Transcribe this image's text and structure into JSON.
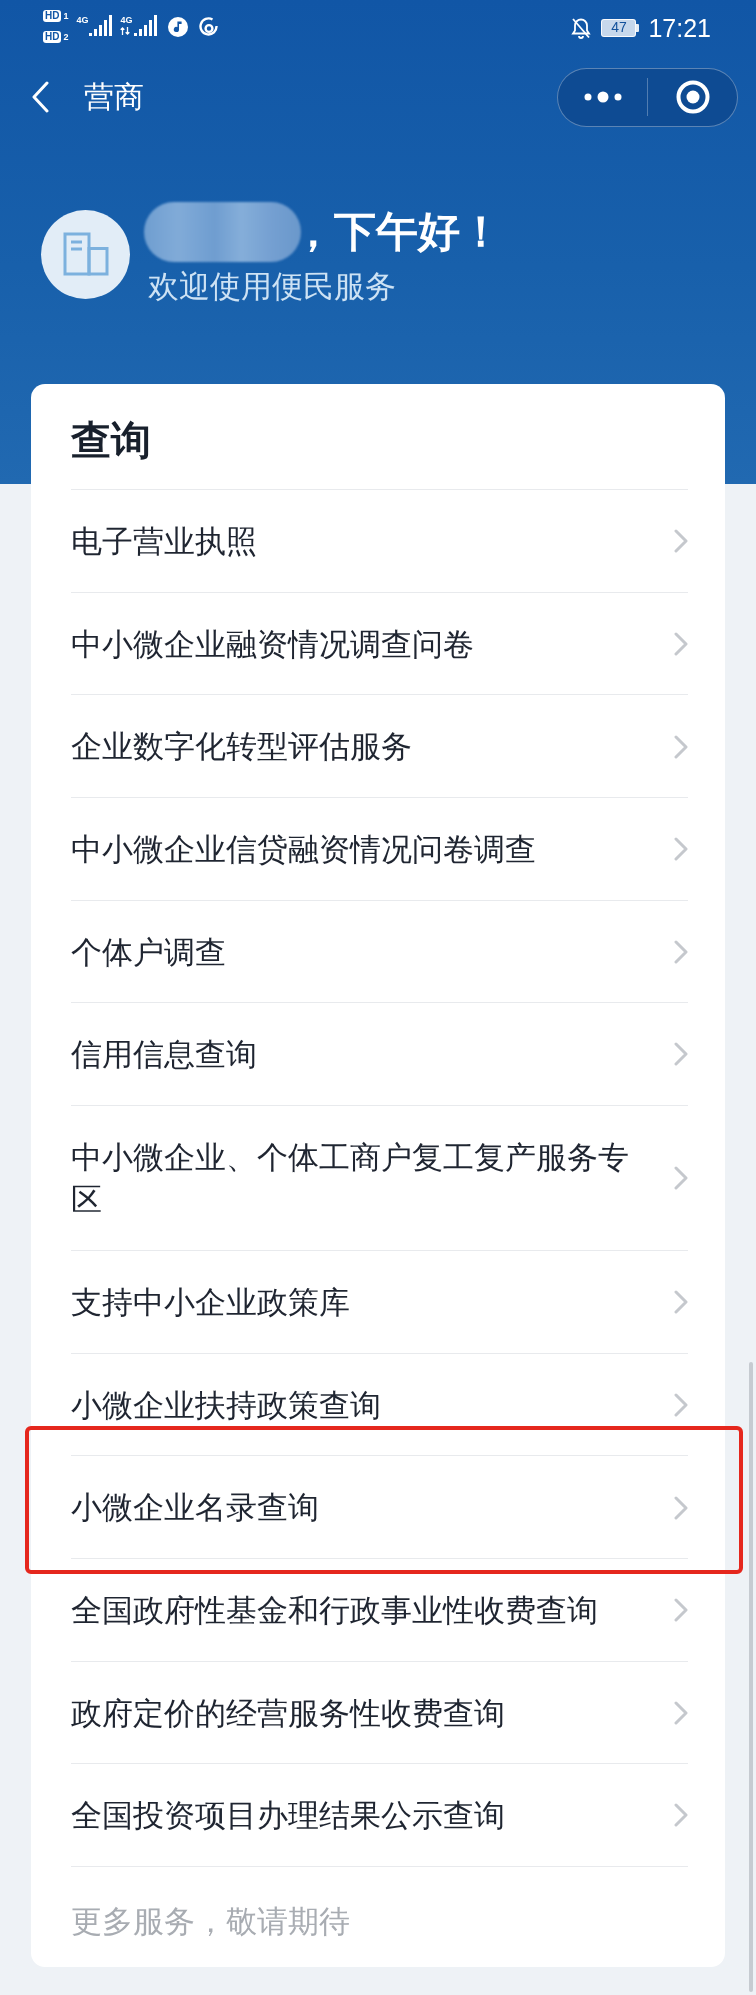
{
  "status_bar": {
    "sim_badges": [
      {
        "label": "HD",
        "slot": "1"
      },
      {
        "label": "HD",
        "slot": "2"
      }
    ],
    "networks": [
      {
        "label": "4G",
        "data_arrows": false
      },
      {
        "label": "4G",
        "data_arrows": true
      }
    ],
    "battery": "47",
    "time": "17:21"
  },
  "nav_bar": {
    "title": "营商"
  },
  "greeting": {
    "name_blurred": true,
    "text": "，下午好！",
    "subtitle": "欢迎使用便民服务"
  },
  "sections": [
    {
      "title": "查询",
      "items": [
        {
          "label": "电子营业执照",
          "highlighted": false
        },
        {
          "label": "中小微企业融资情况调查问卷",
          "highlighted": false
        },
        {
          "label": "企业数字化转型评估服务",
          "highlighted": false
        },
        {
          "label": "中小微企业信贷融资情况问卷调查",
          "highlighted": false
        },
        {
          "label": "个体户调查",
          "highlighted": false
        },
        {
          "label": "信用信息查询",
          "highlighted": false
        },
        {
          "label": "中小微企业、个体工商户复工复产服务专区",
          "highlighted": false
        },
        {
          "label": "支持中小企业政策库",
          "highlighted": false
        },
        {
          "label": "小微企业扶持政策查询",
          "highlighted": false
        },
        {
          "label": "小微企业名录查询",
          "highlighted": true
        },
        {
          "label": "全国政府性基金和行政事业性收费查询",
          "highlighted": false
        },
        {
          "label": "政府定价的经营服务性收费查询",
          "highlighted": false
        },
        {
          "label": "全国投资项目办理结果公示查询",
          "highlighted": false
        }
      ],
      "footer": "更多服务，敬请期待"
    }
  ]
}
